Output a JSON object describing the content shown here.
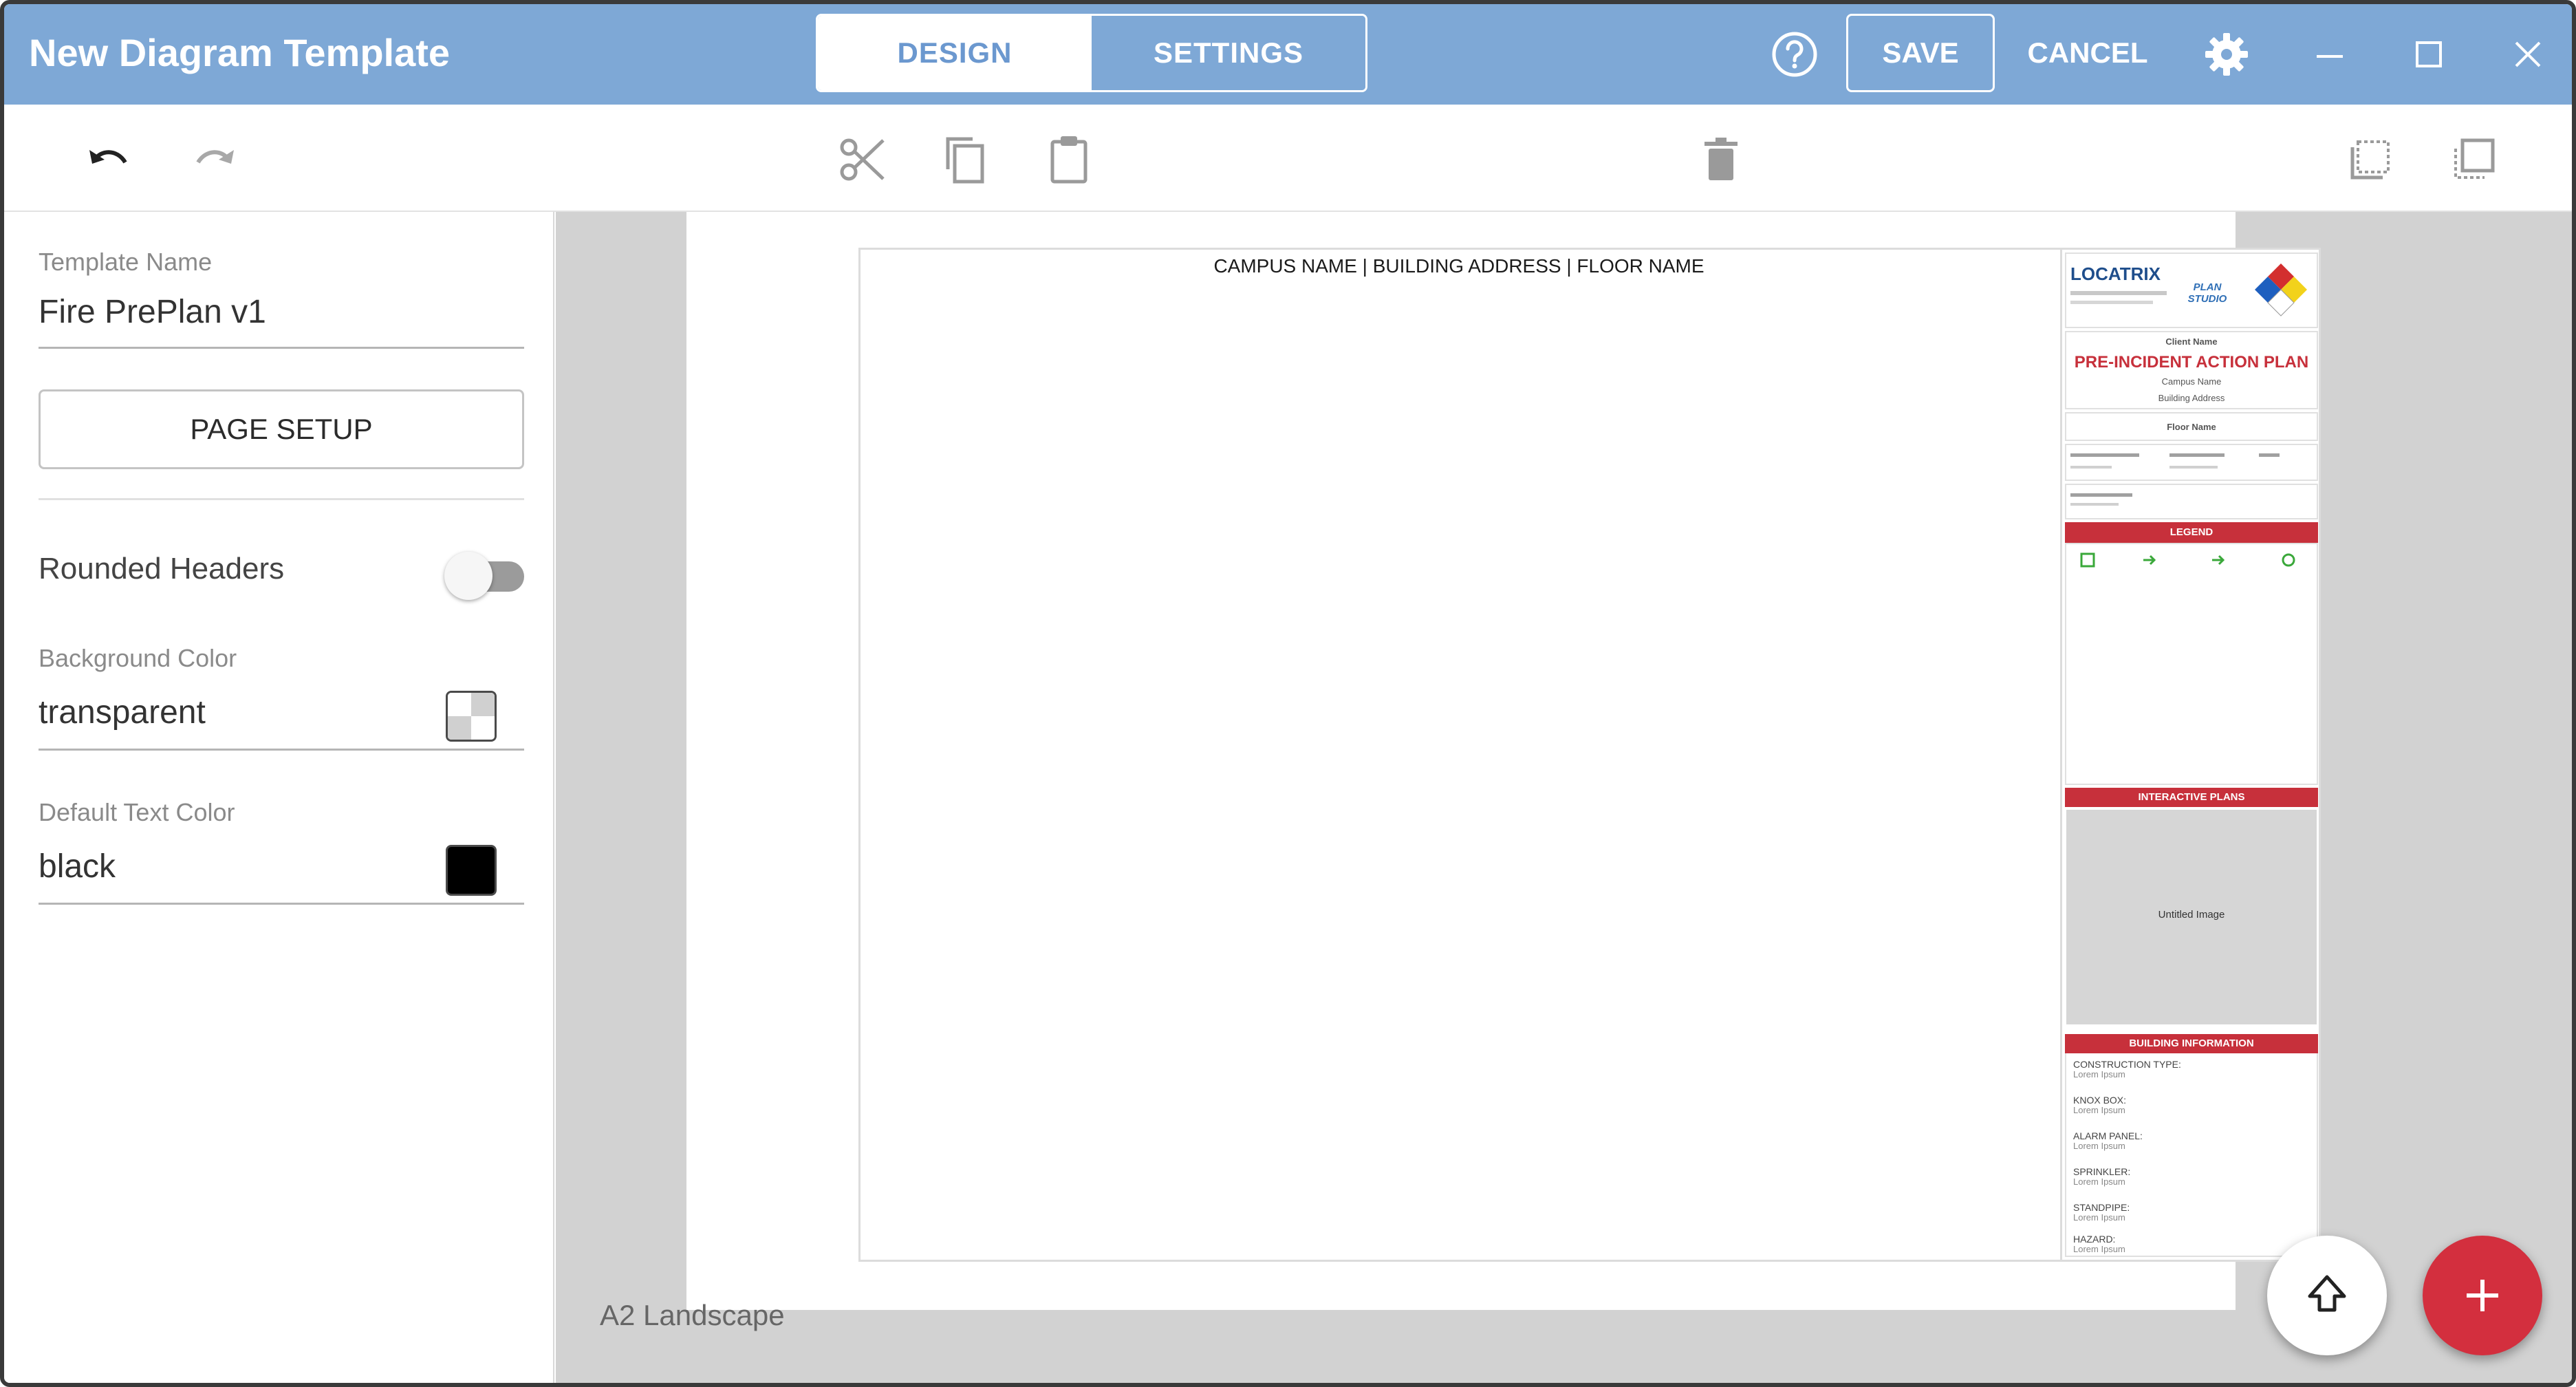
{
  "window": {
    "title": "New Diagram Template",
    "tabs": [
      {
        "label": "DESIGN",
        "active": true
      },
      {
        "label": "SETTINGS",
        "active": false
      }
    ],
    "save_label": "SAVE",
    "cancel_label": "CANCEL",
    "icons": [
      "help-icon",
      "gear-icon",
      "minimize-icon",
      "maximize-icon",
      "close-icon"
    ]
  },
  "toolbar": {
    "icons": [
      "undo-icon",
      "redo-icon",
      "cut-icon",
      "copy-icon",
      "paste-icon",
      "delete-icon",
      "select-area-icon",
      "duplicate-icon"
    ]
  },
  "sidebar": {
    "template_name_label": "Template Name",
    "template_name_value": "Fire PrePlan v1",
    "page_setup_label": "PAGE SETUP",
    "rounded_headers_label": "Rounded Headers",
    "rounded_headers_on": false,
    "bg_color_label": "Background Color",
    "bg_color_value": "transparent",
    "text_color_label": "Default Text Color",
    "text_color_value": "black"
  },
  "canvas": {
    "header_text": "CAMPUS NAME | BUILDING ADDRESS | FLOOR NAME",
    "page_size": "A2 Landscape",
    "titleblock": {
      "logo_text": "LOCATRIX",
      "logo_sub": "PLAN STUDIO",
      "client_name": "Client Name",
      "plan_title": "PRE-INCIDENT ACTION PLAN",
      "campus_name": "Campus Name",
      "building_address": "Building Address",
      "floor_name": "Floor Name",
      "legend_header": "LEGEND",
      "interactive_header": "INTERACTIVE PLANS",
      "image_placeholder": "Untitled Image",
      "building_info_header": "BUILDING INFORMATION",
      "building_info": [
        {
          "label": "CONSTRUCTION TYPE:",
          "value": "Lorem Ipsum"
        },
        {
          "label": "KNOX BOX:",
          "value": "Lorem Ipsum"
        },
        {
          "label": "ALARM PANEL:",
          "value": "Lorem Ipsum"
        },
        {
          "label": "SPRINKLER:",
          "value": "Lorem Ipsum"
        },
        {
          "label": "STANDPIPE:",
          "value": "Lorem Ipsum"
        },
        {
          "label": "HAZARD:",
          "value": "Lorem Ipsum"
        }
      ]
    }
  },
  "fab": {
    "up_icon": "arrow-up-icon",
    "add_icon": "plus-icon"
  },
  "colors": {
    "titlebar": "#7ea8d6",
    "accent_red": "#c7303b",
    "fab_red": "#d32f3e"
  }
}
